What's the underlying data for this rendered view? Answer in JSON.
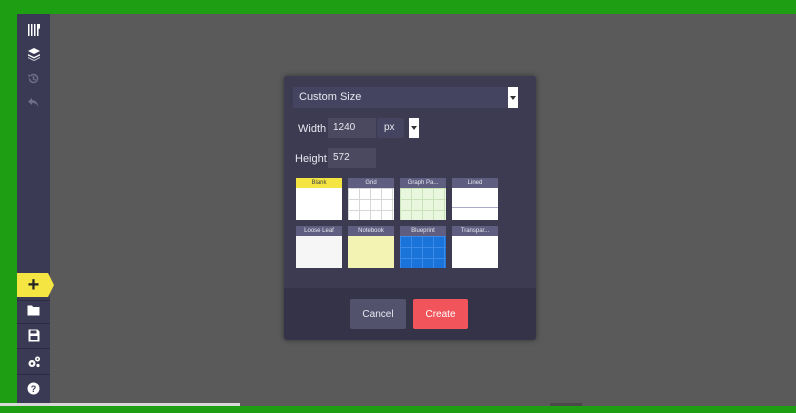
{
  "sidebar": {
    "top_items": [
      {
        "icon": "tools-icon",
        "enabled": true
      },
      {
        "icon": "layers-icon",
        "enabled": true
      },
      {
        "icon": "history-icon",
        "enabled": false
      },
      {
        "icon": "undo-icon",
        "enabled": false
      }
    ],
    "bottom_items": [
      {
        "icon": "plus-icon",
        "highlight": "#f4e542"
      },
      {
        "icon": "folder-icon"
      },
      {
        "icon": "save-icon"
      },
      {
        "icon": "settings-gears-icon"
      },
      {
        "icon": "help-icon"
      }
    ]
  },
  "dialog": {
    "size_preset": "Custom Size",
    "width_label": "Width",
    "width_value": "1240",
    "unit": "px",
    "height_label": "Height",
    "height_value": "572",
    "templates": [
      {
        "label": "Blank",
        "selected": true
      },
      {
        "label": "Grid"
      },
      {
        "label": "Graph Pa..."
      },
      {
        "label": "Lined"
      },
      {
        "label": "Loose Leaf"
      },
      {
        "label": "Notebook"
      },
      {
        "label": "Blueprint"
      },
      {
        "label": "Transpar..."
      }
    ],
    "cancel_label": "Cancel",
    "create_label": "Create"
  },
  "colors": {
    "frame": "#1e9e12",
    "sidebar": "#3b3a55",
    "canvas": "#5a5a5a",
    "dialog": "#3c3b52",
    "accent_yellow": "#f4e542",
    "create_red": "#f2545b",
    "blueprint": "#1a73d9",
    "notebook": "#f3f3b3",
    "graph": "#e9f7df"
  }
}
